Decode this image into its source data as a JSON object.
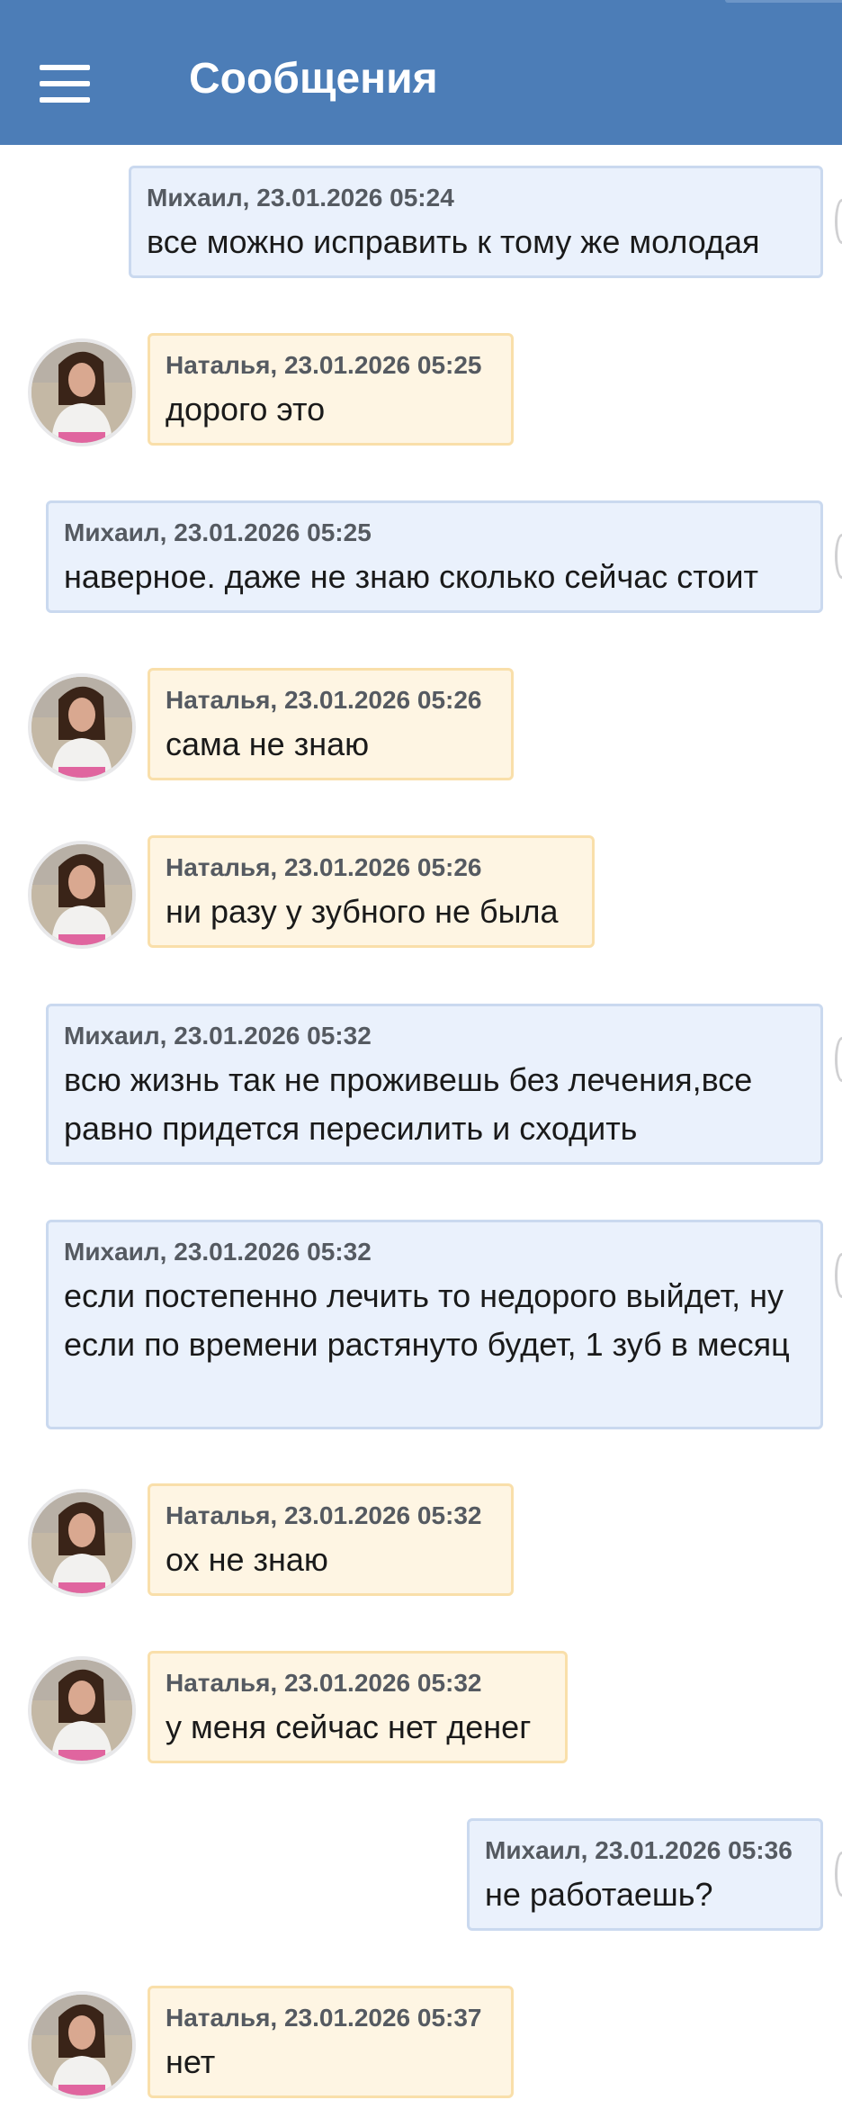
{
  "header": {
    "title": "Сообщения",
    "menu_icon": "hamburger-menu-icon",
    "background": "#4c7db7"
  },
  "colors": {
    "outgoing_bubble": "#eaf1fc",
    "outgoing_border": "#cad9ef",
    "incoming_bubble": "#fef5e3",
    "incoming_border": "#f9dfaa"
  },
  "messages": [
    {
      "direction": "out",
      "meta": "Михаил, 23.01.2026 05:24",
      "text": "все можно исправить к тому же молодая"
    },
    {
      "direction": "in",
      "meta": "Наталья, 23.01.2026 05:25",
      "text": "дорого это"
    },
    {
      "direction": "out",
      "meta": "Михаил, 23.01.2026 05:25",
      "text": "наверное. даже не знаю сколько сейчас стоит"
    },
    {
      "direction": "in",
      "meta": "Наталья, 23.01.2026 05:26",
      "text": "сама не знаю"
    },
    {
      "direction": "in",
      "meta": "Наталья, 23.01.2026 05:26",
      "text": "ни разу у зубного не была"
    },
    {
      "direction": "out",
      "meta": "Михаил, 23.01.2026 05:32",
      "text": "всю жизнь так не проживешь без лечения,все равно придется пересилить и сходить"
    },
    {
      "direction": "out",
      "meta": "Михаил, 23.01.2026 05:32",
      "text": "если постепенно лечить то недорого выйдет, ну если по времени растянуто будет, 1 зуб в месяц"
    },
    {
      "direction": "in",
      "meta": "Наталья, 23.01.2026 05:32",
      "text": "ох не знаю"
    },
    {
      "direction": "in",
      "meta": "Наталья, 23.01.2026 05:32",
      "text": "у меня сейчас нет денег"
    },
    {
      "direction": "out",
      "meta": "Михаил, 23.01.2026 05:36",
      "text": "не работаешь?"
    },
    {
      "direction": "in",
      "meta": "Наталья, 23.01.2026 05:37",
      "text": "нет"
    }
  ]
}
